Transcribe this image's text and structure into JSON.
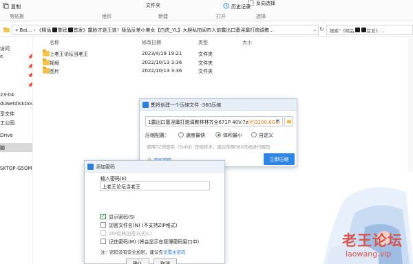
{
  "ribbon": {
    "copy_label": "复制",
    "clipboard_group": "剪贴板",
    "organize_group": "组织",
    "new_group": "新建",
    "open_group": "打开",
    "select_group": "选择",
    "folder_label": "文件夹",
    "history_label": "历史记录",
    "invert_select_label": "反向选择"
  },
  "address": {
    "back_label": "«",
    "path_prefix": "Bai...",
    "path_sep": "›",
    "path_part1": "《精品",
    "path_part2": "重磅",
    "path_part3": "首发》露脸才是王道！极品反差小美女【白虎_YL】大胆私拍闺市人前露出口塞淫靡打炮调教...",
    "search_prefix": "搜索\"《精品",
    "search_suffix": "首发》..."
  },
  "nav": {
    "items": [
      "访问",
      "e",
      "",
      "23-04",
      "duNetdiskDow",
      "享文件",
      "工公园",
      "Drive",
      "脑",
      "",
      "",
      "",
      "SKTOP-G5OMD"
    ],
    "selected_index": 8
  },
  "columns": {
    "name": "名称",
    "date": "修改日期",
    "type": "类型",
    "size": "大小"
  },
  "files": [
    {
      "name": "上老王论坛当老王",
      "date": "2023/4/19 19:21",
      "type": "文件夹"
    },
    {
      "name": "视频",
      "date": "2022/10/13 3:36",
      "type": "文件夹"
    },
    {
      "name": "图片",
      "date": "2022/10/13 3:36",
      "type": "文件夹"
    }
  ],
  "compress_dialog": {
    "title": "您将创建一个压缩文件 -360压缩",
    "filename": "1露出口塞淫靡打炮调教林林齐全671P 40V.7z",
    "filesize": "(约3200.6GB)",
    "config_label": "压缩配置：",
    "options": [
      "速度最快",
      "体积最小",
      "自定义"
    ],
    "selected_option": 1,
    "hint": "使用7Z的固实（Solid）压缩技术，建议使用360压缩进行解压",
    "add_password": "添加密码",
    "start_button": "立即压缩"
  },
  "password_dialog": {
    "title": "添加密码",
    "input_label": "输入密码(E)",
    "input_value": "上老王论坛当老王",
    "options": [
      {
        "label": "显示密码(S)",
        "checked": true,
        "disabled": false
      },
      {
        "label": "加密文件名(N) (不支持ZIP格式)",
        "checked": false,
        "disabled": false
      },
      {
        "label": "ZIP经典加密方式(L)",
        "checked": false,
        "disabled": true
      },
      {
        "label": "记住密码(M) (将会显示在管理密码窗口中)",
        "checked": false,
        "disabled": false
      }
    ],
    "note_text": "注：密码没有安全加密，建议先",
    "note_link": "设置主密码",
    "ok_button": "确认",
    "cancel_button": "取消"
  },
  "watermark": {
    "line1": "老王论坛",
    "line2": "laowang.vip"
  },
  "colors": {
    "accent": "#2d86e6",
    "folder": "#f3c34b",
    "watermark": "#d9534f",
    "filesize": "#e87b13"
  }
}
